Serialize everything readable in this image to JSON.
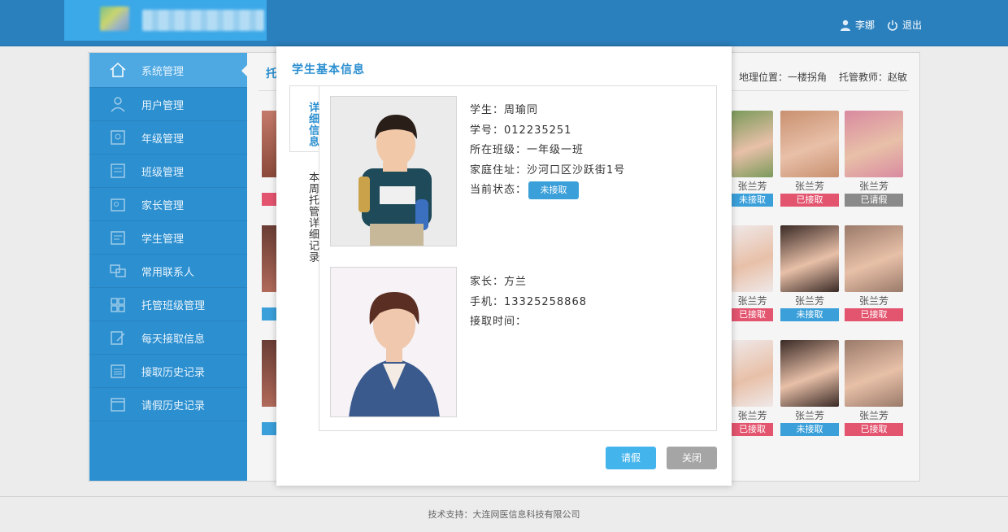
{
  "header": {
    "user_name": "李娜",
    "logout_label": "退出"
  },
  "sidebar": {
    "items": [
      {
        "label": "系统管理",
        "icon": "home-icon",
        "active": true
      },
      {
        "label": "用户管理",
        "icon": "user-icon"
      },
      {
        "label": "年级管理",
        "icon": "grade-icon"
      },
      {
        "label": "班级管理",
        "icon": "class-icon"
      },
      {
        "label": "家长管理",
        "icon": "parent-icon"
      },
      {
        "label": "学生管理",
        "icon": "student-icon"
      },
      {
        "label": "常用联系人",
        "icon": "contacts-icon"
      },
      {
        "label": "托管班级管理",
        "icon": "grid-icon"
      },
      {
        "label": "每天接取信息",
        "icon": "edit-icon"
      },
      {
        "label": "接取历史记录",
        "icon": "list-icon"
      },
      {
        "label": "请假历史记录",
        "icon": "window-icon"
      }
    ]
  },
  "page": {
    "title_partial": "托",
    "location_label": "地理位置：一楼拐角",
    "teacher_label": "托管教师：赵敏"
  },
  "grid": {
    "rows": [
      [
        {
          "name": "张兰芳",
          "status": "未接取",
          "color": "blue"
        },
        {
          "name": "张兰芳",
          "status": "已接取",
          "color": "red"
        },
        {
          "name": "张兰芳",
          "status": "已请假",
          "color": "gray"
        }
      ],
      [
        {
          "name": "张兰芳",
          "status": "已接取",
          "color": "red"
        },
        {
          "name": "张兰芳",
          "status": "未接取",
          "color": "blue"
        },
        {
          "name": "张兰芳",
          "status": "已接取",
          "color": "red"
        }
      ],
      [
        {
          "name": "张兰芳",
          "status": "已接取",
          "color": "red"
        },
        {
          "name": "张兰芳",
          "status": "未接取",
          "color": "blue"
        },
        {
          "name": "张兰芳",
          "status": "已接取",
          "color": "red"
        }
      ]
    ]
  },
  "dialog": {
    "title": "学生基本信息",
    "tabs": [
      "详细信息",
      "本周托管详细记录"
    ],
    "student": {
      "name": "学生：周瑜同",
      "number": "学号：012235251",
      "class": "所在班级：一年级一班",
      "address": "家庭住址：沙河口区沙跃街1号",
      "status_label": "当前状态：",
      "status_value": "未接取"
    },
    "parent": {
      "name": "家长：方兰",
      "phone": "手机：13325258868",
      "pickup_time": "接取时间："
    },
    "buttons": {
      "leave": "请假",
      "close": "关闭"
    }
  },
  "footer": {
    "text": "技术支持：大连网医信息科技有限公司"
  }
}
